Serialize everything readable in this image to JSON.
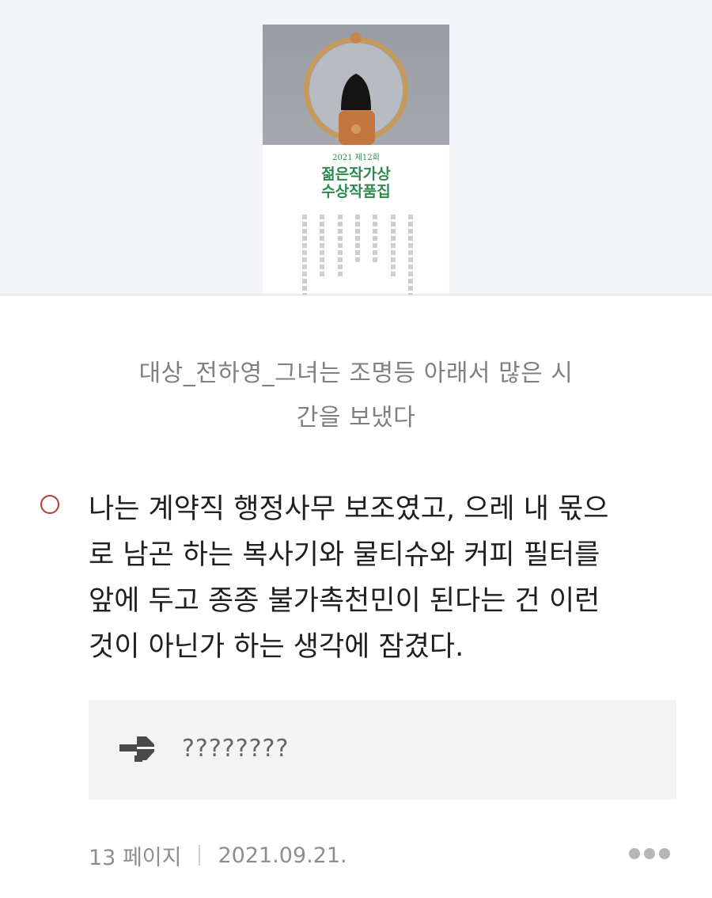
{
  "book": {
    "cover_year": "2021 제12회",
    "cover_title_line1": "젊은작가상",
    "cover_title_line2": "수상작품집",
    "title_line1": "대상_전하영_그녀는 조명등 아래서 많은 시",
    "title_line2": "간을 보냈다"
  },
  "highlight": {
    "color": "#c0392b",
    "lines": [
      "나는 계약직 행정사무 보조였고, 으레 내 몫으",
      "로 남곤 하는 복사기와 물티슈와 커피 필터를",
      "앞에 두고 종종 불가촉천민이 된다는 건 이런",
      "것이 아닌가 하는 생각에 잠겼다."
    ]
  },
  "memo": {
    "icon": "memo-icon",
    "text": "????????"
  },
  "footer": {
    "page": "13 페이지",
    "date": "2021.09.21.",
    "more_icon": "more-dots-icon"
  }
}
